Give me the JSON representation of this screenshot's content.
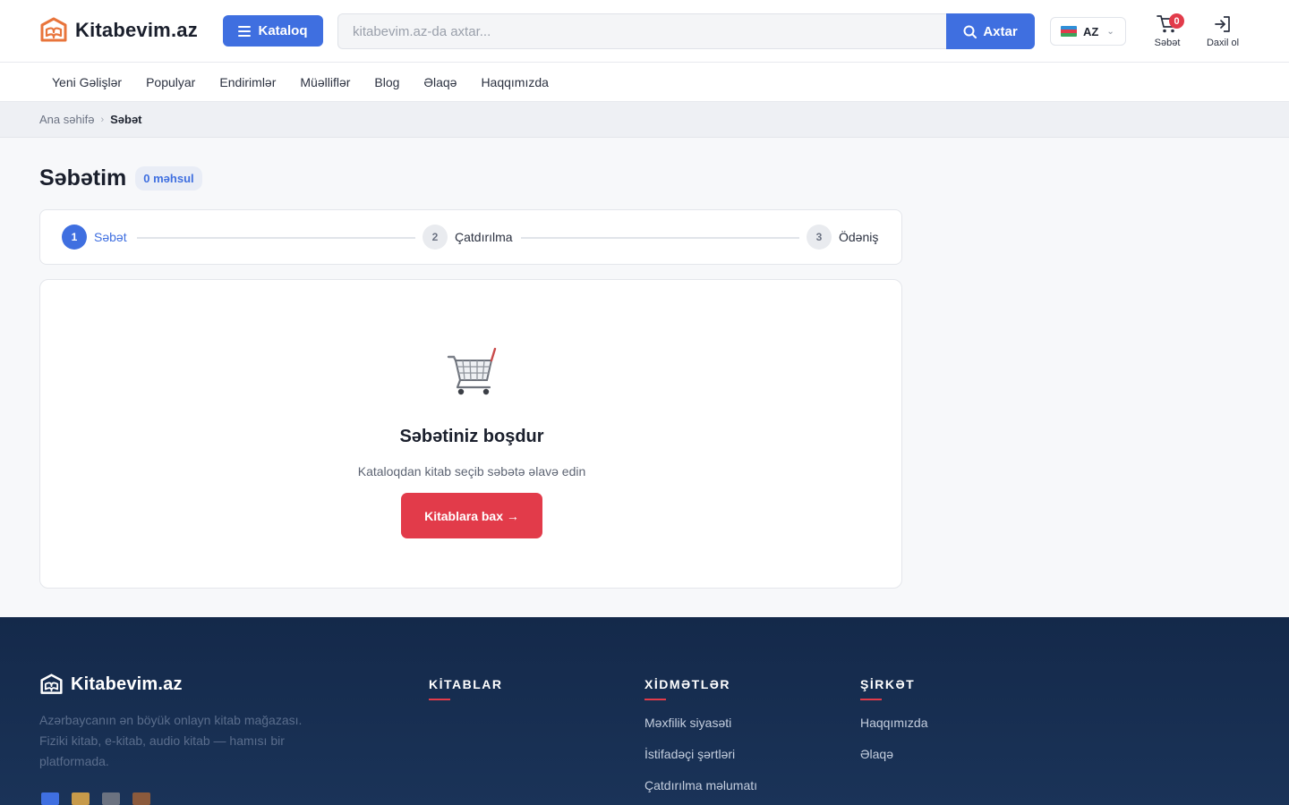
{
  "header": {
    "logo_text": "Kitabevim.az",
    "catalog_label": "Kataloq",
    "search_placeholder": "kitabevim.az-da axtar...",
    "search_button": "Axtar",
    "language": "AZ",
    "cart_label": "Səbət",
    "cart_count": "0",
    "login_label": "Daxil ol"
  },
  "nav": {
    "items": [
      "Yeni Gəlişlər",
      "Populyar",
      "Endirimlər",
      "Müəlliflər",
      "Blog",
      "Əlaqə",
      "Haqqımızda"
    ]
  },
  "breadcrumb": {
    "home": "Ana səhifə",
    "separator": "›",
    "current": "Səbət"
  },
  "page": {
    "title": "Səbətim",
    "item_count": "0 məhsul"
  },
  "steps": [
    {
      "num": "1",
      "label": "Səbət",
      "active": true
    },
    {
      "num": "2",
      "label": "Çatdırılma",
      "active": false
    },
    {
      "num": "3",
      "label": "Ödəniş",
      "active": false
    }
  ],
  "empty_cart": {
    "icon": "shopping-cart-icon",
    "title": "Səbətiniz boşdur",
    "subtitle": "Kataloqdan kitab seçib səbətə əlavə edin",
    "button": "Kitablara bax →"
  },
  "footer": {
    "logo_text": "Kitabevim.az",
    "description": "Azərbaycanın ən böyük onlayn kitab mağazası. Fiziki kitab, e-kitab, audio kitab — hamısı bir platformada.",
    "columns": [
      {
        "title": "KİTABLAR",
        "links": []
      },
      {
        "title": "XİDMƏTLƏR",
        "links": [
          "Məxfilik siyasəti",
          "İstifadəçi şərtləri",
          "Çatdırılma məlumatı"
        ]
      },
      {
        "title": "ŞİRKƏT",
        "links": [
          "Haqqımızda",
          "Əlaqə"
        ]
      }
    ]
  },
  "colors": {
    "primary": "#3f6fe0",
    "accent_red": "#e23b4a",
    "footer_bg": "#14294a",
    "logo_orange": "#e8743b"
  }
}
